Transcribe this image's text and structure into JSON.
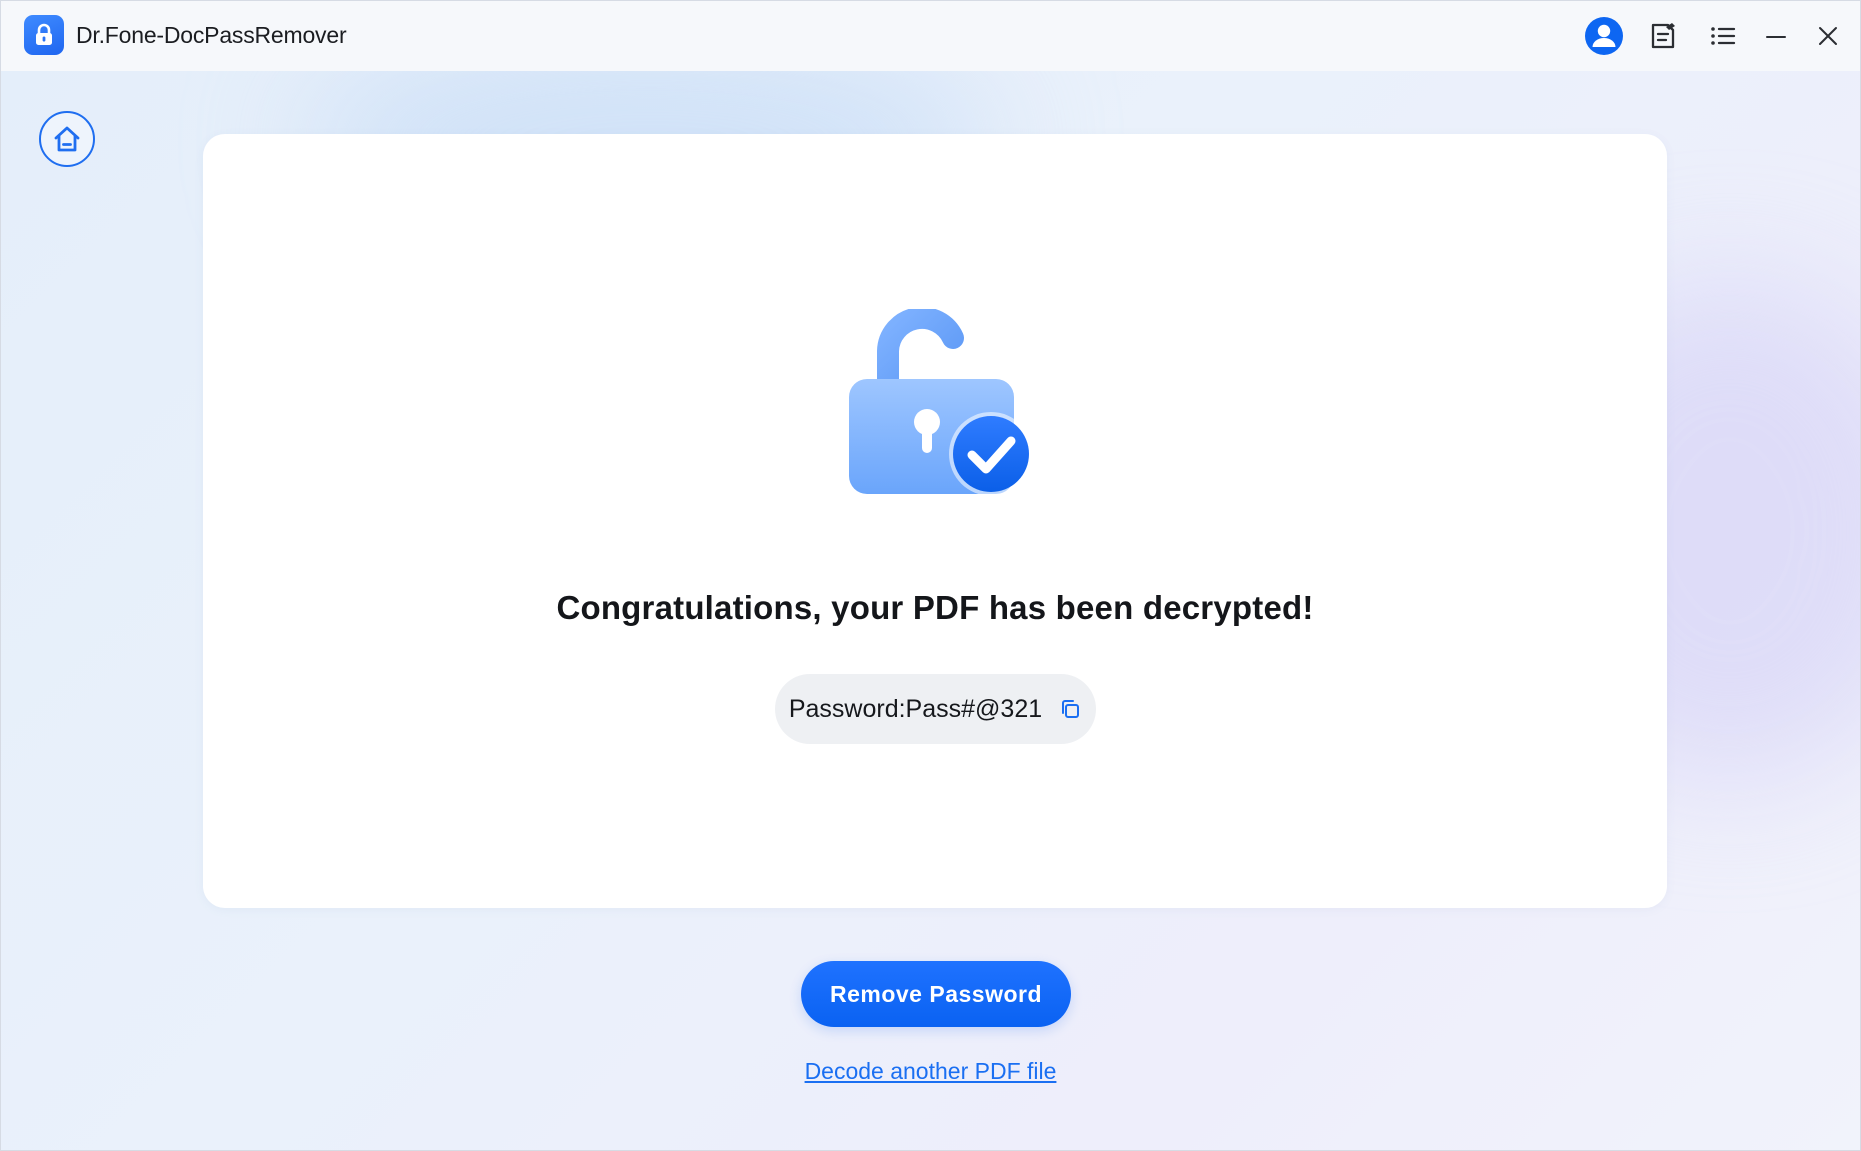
{
  "app": {
    "title": "Dr.Fone-DocPassRemover",
    "accent_color": "#0a66f4"
  },
  "titlebar": {
    "icons": [
      "lock-logo-icon",
      "account-icon",
      "feedback-icon",
      "menu-icon",
      "minimize-icon",
      "close-icon"
    ]
  },
  "nav": {
    "home_icon": "home-icon"
  },
  "result": {
    "illustration": "unlocked-padlock-with-checkmark",
    "headline": "Congratulations, your PDF has been decrypted!",
    "password_text": "Password:Pass#@321",
    "copy_icon": "copy-icon"
  },
  "actions": {
    "remove_label": "Remove Password",
    "decode_link": "Decode another PDF file"
  }
}
